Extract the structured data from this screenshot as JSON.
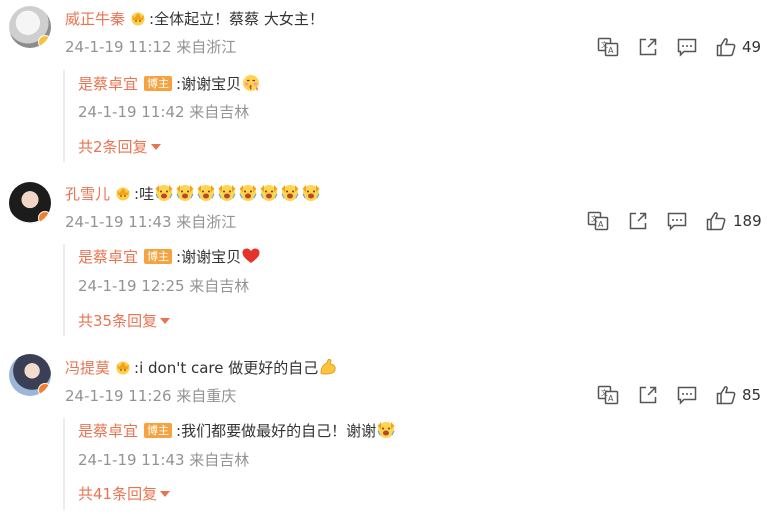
{
  "comments": [
    {
      "user": "威正牛秦",
      "text": ":全体起立！蔡蔡 大女主！",
      "time": "24-1-19 11:12 来自浙江",
      "likes": "49",
      "reply": {
        "user": "是蔡卓宜",
        "badge": "博主",
        "text": ":谢谢宝贝",
        "time": "24-1-19 11:42 来自吉林"
      },
      "more": "共2条回复"
    },
    {
      "user": "孔雪儿",
      "text": ":哇",
      "time": "24-1-19 11:43 来自浙江",
      "likes": "189",
      "reply": {
        "user": "是蔡卓宜",
        "badge": "博主",
        "text": ":谢谢宝贝",
        "time": "24-1-19 12:25 来自吉林"
      },
      "more": "共35条回复"
    },
    {
      "user": "冯提莫",
      "text": ":i don't care 做更好的自己",
      "time": "24-1-19 11:26 来自重庆",
      "likes": "85",
      "reply": {
        "user": "是蔡卓宜",
        "badge": "博主",
        "text": ":我们都要做最好的自己！谢谢",
        "time": "24-1-19 11:43 来自吉林"
      },
      "more": "共41条回复"
    }
  ],
  "icons": [
    "translate-icon",
    "share-icon",
    "comment-icon",
    "thumbs-up-icon"
  ],
  "colors": {
    "username": "#eb7350",
    "meta": "#939393",
    "badge": "#f4a340"
  }
}
